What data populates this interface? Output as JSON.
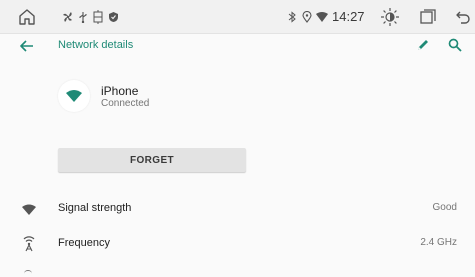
{
  "status_bar": {
    "time": "14:27",
    "icons": [
      "home-icon",
      "fan-icon",
      "usb-icon",
      "split-screen-icon",
      "shield-icon",
      "bluetooth-icon",
      "location-icon",
      "wifi-status-icon",
      "brightness-icon",
      "recents-icon",
      "back-icon"
    ]
  },
  "app_bar": {
    "title": "Network details",
    "icons": [
      "back-arrow-icon",
      "edit-icon",
      "search-icon"
    ]
  },
  "network": {
    "name": "iPhone",
    "status": "Connected"
  },
  "forget_button": {
    "label": "FORGET"
  },
  "details": [
    {
      "label": "Signal strength",
      "value": "Good",
      "icon": "signal-strength-icon"
    },
    {
      "label": "Frequency",
      "value": "2.4 GHz",
      "icon": "frequency-icon"
    }
  ],
  "colors": {
    "accent": "#1f8a76",
    "background": "#fafafa",
    "status_bar": "#f1f1f1"
  }
}
